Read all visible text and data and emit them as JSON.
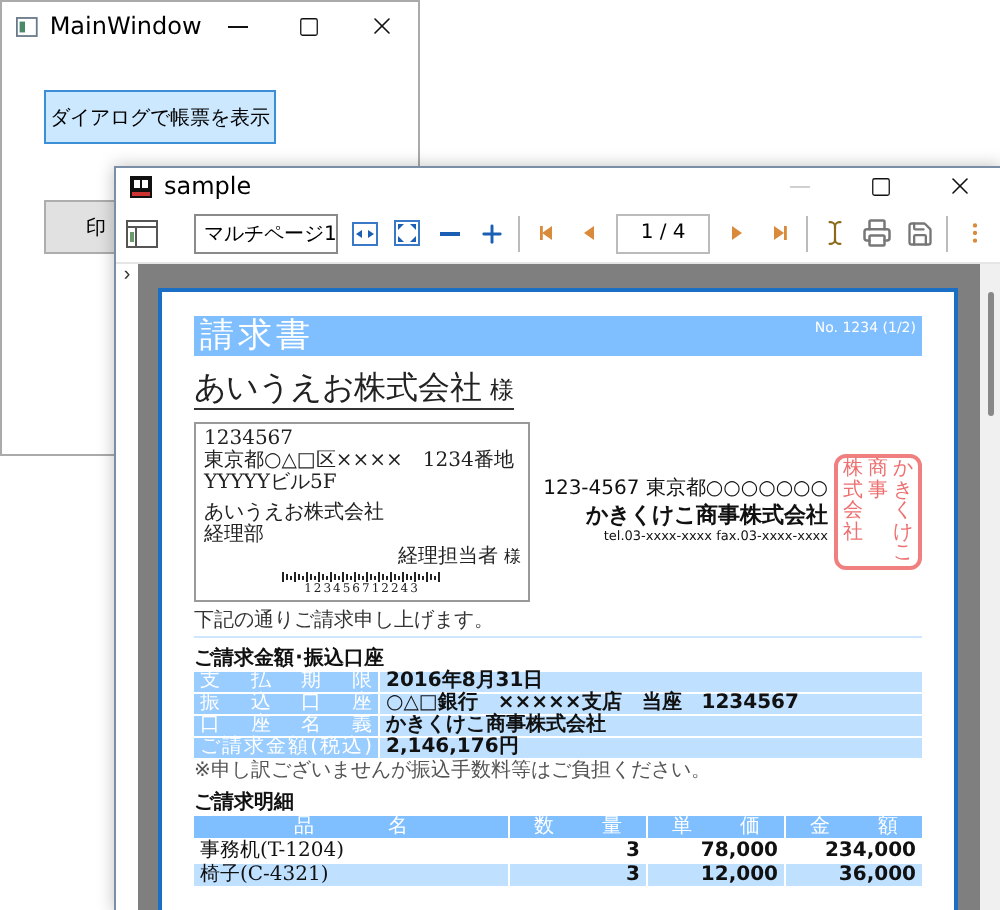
{
  "main_window": {
    "title": "MainWindow",
    "controls": [
      {
        "kind": "minimize",
        "disabled": false
      },
      {
        "kind": "maximize",
        "disabled": false
      },
      {
        "kind": "close",
        "disabled": false
      }
    ],
    "buttons": [
      {
        "label": "ダイアログで帳票を表示",
        "focused": true
      },
      {
        "label": "印",
        "focused": false
      }
    ]
  },
  "viewer_window": {
    "title": "sample",
    "controls": [
      {
        "kind": "minimize",
        "disabled": true
      },
      {
        "kind": "maximize",
        "disabled": false
      },
      {
        "kind": "close",
        "disabled": false
      }
    ],
    "toolbar": {
      "zoom_mode": "マルチページ1",
      "page": "1 / 4"
    },
    "sidebar_toggle": "›",
    "document": {
      "title": "請求書",
      "number": "No. 1234 (1/2)",
      "customer": "あいうえお株式会社",
      "honorific": "様",
      "address": {
        "postal": "1234567",
        "lines": [
          "東京都○△□区××××　1234番地",
          "YYYYYビル5F"
        ],
        "company": [
          "あいうえお株式会社",
          "経理部"
        ],
        "person": "経理担当者",
        "honorific": "様",
        "barcode_digits": "123456712243"
      },
      "issuer": {
        "address": "123-4567 東京都○○○○○○○",
        "name": "かきくけこ商事株式会社",
        "contact": "tel.03-xxxx-xxxx  fax.03-xxxx-xxxx",
        "stamp": [
          "株式会社",
          "商事",
          "かきくけこ"
        ]
      },
      "message": "下記の通りご請求申し上げます。",
      "billing": {
        "title": "ご請求金額･振込口座",
        "rows": [
          {
            "label": "支払期限",
            "value": "2016年8月31日"
          },
          {
            "label": "振込口座",
            "value": "○△□銀行　×××××支店　当座　1234567"
          },
          {
            "label": "口座名義",
            "value": "かきくけこ商事株式会社"
          },
          {
            "label": "ご請求金額(税込)",
            "value": "2,146,176円"
          }
        ],
        "note": "※申し訳ございませんが振込手数料等はご負担ください。"
      },
      "details": {
        "title": "ご請求明細",
        "columns": [
          "品名",
          "数量",
          "単価",
          "金額"
        ],
        "rows": [
          {
            "cells": [
              "事務机(T-1204)",
              "3",
              "78,000",
              "234,000"
            ],
            "shaded": false
          },
          {
            "cells": [
              "椅子(C-4321)",
              "3",
              "12,000",
              "36,000"
            ],
            "shaded": true
          }
        ]
      }
    }
  }
}
